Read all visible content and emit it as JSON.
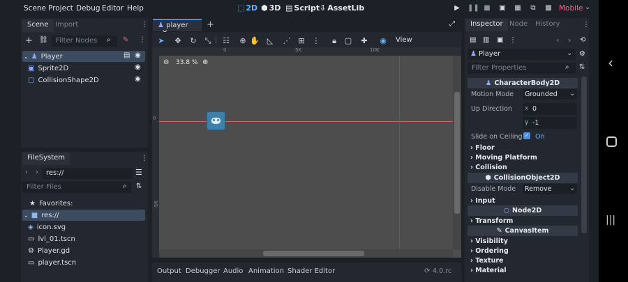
{
  "menu": [
    "Scene",
    "Project",
    "Debug",
    "Editor",
    "Help"
  ],
  "workspaces": [
    {
      "label": "2D",
      "icon": "canvas-icon",
      "active": true
    },
    {
      "label": "3D",
      "icon": "cube-icon",
      "active": false
    },
    {
      "label": "Script",
      "icon": "script-icon",
      "active": false
    },
    {
      "label": "AssetLib",
      "icon": "download-icon",
      "active": false
    }
  ],
  "renderer": "Mobile",
  "scene_dock": {
    "tabs": [
      "Scene",
      "Import"
    ],
    "filter_placeholder": "Filter Nodes",
    "nodes": [
      {
        "name": "Player",
        "icon": "character-body-icon",
        "selected": true
      },
      {
        "name": "Sprite2D",
        "icon": "sprite-icon",
        "selected": false
      },
      {
        "name": "CollisionShape2D",
        "icon": "collision-shape-icon",
        "selected": false
      }
    ]
  },
  "filesystem": {
    "tab": "FileSystem",
    "path": "res://",
    "filter_placeholder": "Filter Files",
    "favorites": "Favorites:",
    "root": "res://",
    "files": [
      {
        "name": "icon.svg",
        "icon": "image-icon"
      },
      {
        "name": "lvl_01.tscn",
        "icon": "scene-icon"
      },
      {
        "name": "Player.gd",
        "icon": "gear-icon"
      },
      {
        "name": "player.tscn",
        "icon": "scene-icon"
      }
    ]
  },
  "editor": {
    "tab": "player",
    "zoom": "33.8 %",
    "view_label": "View",
    "ruler_labels": [
      "0",
      "5K",
      "10K",
      "-5K"
    ]
  },
  "bottom_tabs": [
    "Output",
    "Debugger",
    "Audio",
    "Animation",
    "Shader Editor"
  ],
  "version": "4.0.rc",
  "inspector": {
    "tabs": [
      "Inspector",
      "Node",
      "History"
    ],
    "node": "Player",
    "filter_placeholder": "Filter Properties",
    "sections": {
      "character": "CharacterBody2D",
      "collision_object": "CollisionObject2D",
      "node2d": "Node2D",
      "canvas_item": "CanvasItem"
    },
    "motion_mode": {
      "label": "Motion Mode",
      "value": "Grounded"
    },
    "up_direction": {
      "label": "Up Direction",
      "x_label": "x",
      "x": "0",
      "y_label": "y",
      "y": "-1"
    },
    "slide_on_ceiling": {
      "label": "Slide on Ceiling",
      "value": "On"
    },
    "groups1": [
      "Floor",
      "Moving Platform",
      "Collision"
    ],
    "disable_mode": {
      "label": "Disable Mode",
      "value": "Remove"
    },
    "input": "Input",
    "transform": "Transform",
    "groups2": [
      "Visibility",
      "Ordering",
      "Texture",
      "Material"
    ]
  },
  "colors": {
    "accent": "#4b90e2",
    "guide": "#e05a6a",
    "canvas": "#4d4d4d"
  }
}
